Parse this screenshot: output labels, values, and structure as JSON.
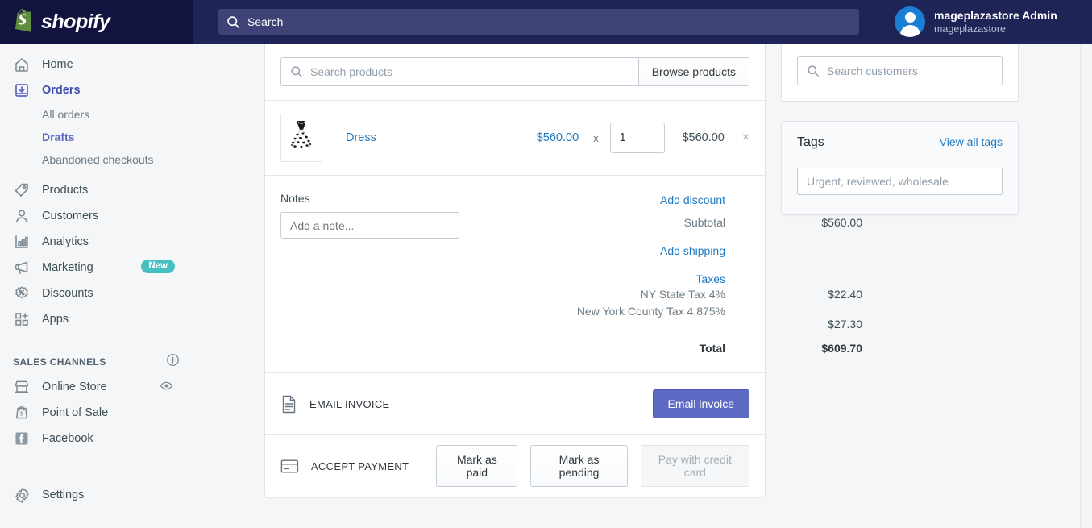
{
  "topbar": {
    "brand": "shopify",
    "search_placeholder": "Search",
    "account_name": "mageplazastore Admin",
    "account_store": "mageplazastore"
  },
  "sidebar": {
    "items": [
      {
        "label": "Home",
        "icon": "home-icon"
      },
      {
        "label": "Orders",
        "icon": "orders-icon"
      },
      {
        "label": "Products",
        "icon": "tag-icon"
      },
      {
        "label": "Customers",
        "icon": "person-icon"
      },
      {
        "label": "Analytics",
        "icon": "bar-chart-icon"
      },
      {
        "label": "Marketing",
        "icon": "megaphone-icon",
        "badge": "New"
      },
      {
        "label": "Discounts",
        "icon": "discount-icon"
      },
      {
        "label": "Apps",
        "icon": "apps-icon"
      }
    ],
    "order_subitems": [
      {
        "label": "All orders"
      },
      {
        "label": "Drafts"
      },
      {
        "label": "Abandoned checkouts"
      }
    ],
    "sales_channels_header": "SALES CHANNELS",
    "channels": [
      {
        "label": "Online Store",
        "icon": "store-icon"
      },
      {
        "label": "Point of Sale",
        "icon": "pos-icon"
      },
      {
        "label": "Facebook",
        "icon": "facebook-icon"
      }
    ],
    "settings_label": "Settings"
  },
  "order": {
    "product_search_placeholder": "Search products",
    "browse_products_label": "Browse products",
    "line_item": {
      "name": "Dress",
      "unit_price": "$560.00",
      "multiply_symbol": "x",
      "quantity": "1",
      "line_total": "$560.00",
      "remove_symbol": "×"
    },
    "notes_title": "Notes",
    "note_placeholder": "Add a note...",
    "totals": [
      {
        "label": "Add discount",
        "value": "—",
        "style": "link"
      },
      {
        "label": "Subtotal",
        "value": "$560.00",
        "style": "muted"
      },
      {
        "label": "Add shipping",
        "value": "—",
        "style": "link"
      },
      {
        "label": "Taxes",
        "value": "",
        "style": "link"
      },
      {
        "label": "NY State Tax 4%",
        "value": "$22.40",
        "style": "muted"
      },
      {
        "label": "New York County Tax 4.875%",
        "value": "$27.30",
        "style": "muted"
      },
      {
        "label": "Total",
        "value": "$609.70",
        "style": "bold"
      }
    ],
    "email_invoice_label": "EMAIL INVOICE",
    "email_invoice_button": "Email invoice",
    "accept_payment_label": "ACCEPT PAYMENT",
    "mark_as_paid_label": "Mark as paid",
    "mark_as_pending_label": "Mark as pending",
    "pay_with_credit_card_label": "Pay with credit card"
  },
  "right": {
    "customer_search_placeholder": "Search customers",
    "tags_title": "Tags",
    "view_all_tags_label": "View all tags",
    "tags_placeholder": "Urgent, reviewed, wholesale"
  },
  "colors": {
    "topbar_bg": "#1f2457",
    "logo_bg": "#12133f",
    "accent_indigo": "#5c6ac4",
    "link_blue": "#1f7ac4",
    "badge_teal": "#47c1bf",
    "page_bg": "#f4f6f8"
  }
}
